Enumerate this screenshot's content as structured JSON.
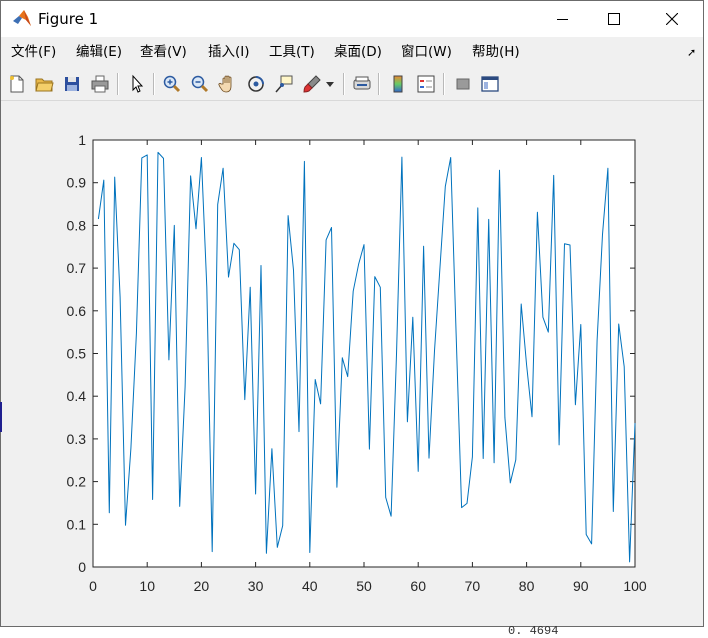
{
  "window": {
    "title": "Figure 1",
    "controls": {
      "minimize": "minimize",
      "maximize": "maximize",
      "close": "close"
    }
  },
  "menu": [
    {
      "label": "文件(F)"
    },
    {
      "label": "编辑(E)"
    },
    {
      "label": "查看(V)"
    },
    {
      "label": "插入(I)"
    },
    {
      "label": "工具(T)"
    },
    {
      "label": "桌面(D)"
    },
    {
      "label": "窗口(W)"
    },
    {
      "label": "帮助(H)"
    }
  ],
  "toolbar": [
    {
      "icon": "new-figure-icon"
    },
    {
      "icon": "open-file-icon"
    },
    {
      "icon": "save-icon"
    },
    {
      "icon": "print-icon"
    },
    {
      "icon": "edit-plot-arrow-icon"
    },
    {
      "icon": "zoom-in-icon"
    },
    {
      "icon": "zoom-out-icon"
    },
    {
      "icon": "pan-hand-icon"
    },
    {
      "icon": "rotate-3d-icon"
    },
    {
      "icon": "data-cursor-icon"
    },
    {
      "icon": "brush-icon"
    },
    {
      "icon": "link-plot-icon"
    },
    {
      "icon": "colorbar-icon"
    },
    {
      "icon": "legend-icon"
    },
    {
      "icon": "hide-plot-tools-icon"
    },
    {
      "icon": "show-plot-tools-icon"
    }
  ],
  "background_text": "0. 4694",
  "chart_data": {
    "type": "line",
    "title": "",
    "xlabel": "",
    "ylabel": "",
    "xlim": [
      0,
      100
    ],
    "ylim": [
      0,
      1
    ],
    "xticks": [
      "0",
      "10",
      "20",
      "30",
      "40",
      "50",
      "60",
      "70",
      "80",
      "90",
      "100"
    ],
    "yticks": [
      "0",
      "0.1",
      "0.2",
      "0.3",
      "0.4",
      "0.5",
      "0.6",
      "0.7",
      "0.8",
      "0.9",
      "1"
    ],
    "grid": false,
    "line_color": "#0072bd",
    "series": [
      {
        "x": [
          1,
          2,
          3,
          4,
          5,
          6,
          7,
          8,
          9,
          10,
          11,
          12,
          13,
          14,
          15,
          16,
          17,
          18,
          19,
          20,
          21,
          22,
          23,
          24,
          25,
          26,
          27,
          28,
          29,
          30,
          31,
          32,
          33,
          34,
          35,
          36,
          37,
          38,
          39,
          40,
          41,
          42,
          43,
          44,
          45,
          46,
          47,
          48,
          49,
          50,
          51,
          52,
          53,
          54,
          55,
          56,
          57,
          58,
          59,
          60,
          61,
          62,
          63,
          64,
          65,
          66,
          67,
          68,
          69,
          70,
          71,
          72,
          73,
          74,
          75,
          76,
          77,
          78,
          79,
          80,
          81,
          82,
          83,
          84,
          85,
          86,
          87,
          88,
          89,
          90,
          91,
          92,
          93,
          94,
          95,
          96,
          97,
          98,
          99,
          100
        ],
        "y": [
          0.815,
          0.906,
          0.127,
          0.913,
          0.632,
          0.098,
          0.278,
          0.547,
          0.958,
          0.965,
          0.158,
          0.971,
          0.957,
          0.485,
          0.8,
          0.142,
          0.422,
          0.916,
          0.792,
          0.959,
          0.656,
          0.036,
          0.849,
          0.934,
          0.679,
          0.758,
          0.743,
          0.392,
          0.655,
          0.171,
          0.706,
          0.032,
          0.277,
          0.046,
          0.097,
          0.823,
          0.695,
          0.317,
          0.95,
          0.034,
          0.439,
          0.382,
          0.766,
          0.795,
          0.187,
          0.49,
          0.446,
          0.646,
          0.709,
          0.755,
          0.276,
          0.68,
          0.655,
          0.163,
          0.119,
          0.498,
          0.96,
          0.34,
          0.585,
          0.224,
          0.751,
          0.255,
          0.506,
          0.699,
          0.891,
          0.959,
          0.547,
          0.139,
          0.149,
          0.258,
          0.841,
          0.254,
          0.814,
          0.244,
          0.929,
          0.35,
          0.197,
          0.251,
          0.616,
          0.473,
          0.352,
          0.831,
          0.585,
          0.55,
          0.917,
          0.286,
          0.757,
          0.754,
          0.38,
          0.568,
          0.076,
          0.054,
          0.531,
          0.779,
          0.934,
          0.13,
          0.569,
          0.469,
          0.012,
          0.337
        ]
      }
    ]
  }
}
